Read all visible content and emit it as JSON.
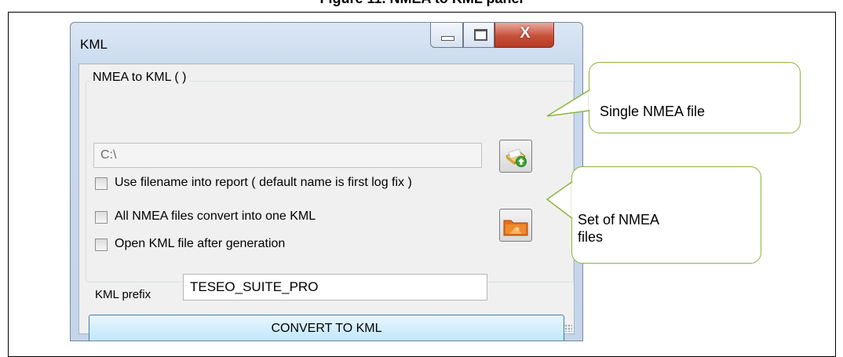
{
  "figure": {
    "caption": "Figure 11. NMEA to KML panel"
  },
  "window": {
    "title": "KML",
    "controls": {
      "minimize": "minimize",
      "maximize": "maximize",
      "close": "X"
    }
  },
  "panel": {
    "group_title": "NMEA to KML (      )",
    "path_value": "C:\\",
    "checkboxes": [
      {
        "label": "Use filename into report ( default name is first log fix )",
        "checked": false
      },
      {
        "label": "All NMEA files convert into one KML",
        "checked": false
      },
      {
        "label": "Open KML file after generation",
        "checked": false
      }
    ],
    "prefix_label": "KML prefix",
    "prefix_value": "TESEO_SUITE_PRO",
    "convert_label": "CONVERT TO KML",
    "single_file_icon": "document-add-icon",
    "folder_icon": "folder-icon"
  },
  "callouts": {
    "single": "Single NMEA file",
    "set_line1": "Set of NMEA",
    "set_line2": "files"
  },
  "colors": {
    "callout_border": "#8cb53d",
    "close_button": "#c7503b",
    "convert_button": "#bee6fd"
  }
}
